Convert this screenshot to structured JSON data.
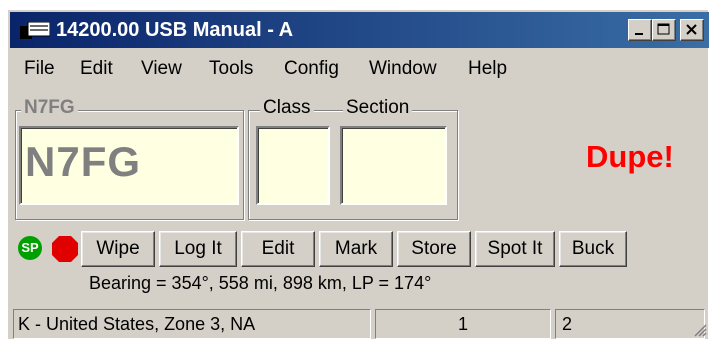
{
  "window": {
    "title": "14200.00 USB Manual - A",
    "controls": {
      "minimize": "minimize-icon",
      "maximize": "maximize-icon",
      "close": "close-icon"
    }
  },
  "menu": [
    "File",
    "Edit",
    "View",
    "Tools",
    "Config",
    "Window",
    "Help"
  ],
  "call_group": {
    "label": "N7FG",
    "value": "N7FG"
  },
  "class_group": {
    "label": "Class",
    "value": ""
  },
  "section_group": {
    "label": "Section",
    "value": ""
  },
  "dupe_text": "Dupe!",
  "indicators": {
    "sp": "SP",
    "sp_color": "#00a000",
    "stop_color": "#e00000"
  },
  "buttons": [
    "Wipe",
    "Log It",
    "Edit",
    "Mark",
    "Store",
    "Spot It",
    "Buck"
  ],
  "bearing": "Bearing = 354°, 558  mi, 898 km, LP = 174°",
  "status": {
    "country": "K - United States, Zone 3, NA",
    "panel2": "1",
    "panel3": "2"
  },
  "colors": {
    "title_start": "#0a246a",
    "title_end": "#3a6ea5",
    "field_bg": "#ffffe1",
    "dupe": "#ff0000"
  }
}
